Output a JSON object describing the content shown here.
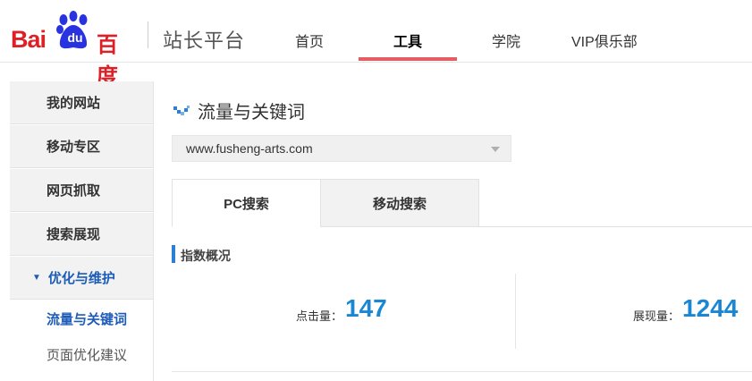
{
  "header": {
    "logo_latin": "Bai",
    "logo_du": "du",
    "logo_cn": "百度",
    "brand": "站长平台",
    "nav": [
      "首页",
      "工具",
      "学院",
      "VIP俱乐部"
    ],
    "active_nav": "工具",
    "accent": "#e55c62",
    "logo_red": "#de1f26",
    "logo_blue": "#2932e1"
  },
  "sidebar": {
    "items": [
      {
        "label": "我的网站"
      },
      {
        "label": "移动专区"
      },
      {
        "label": "网页抓取"
      },
      {
        "label": "搜索展现"
      },
      {
        "label": "优化与维护",
        "expanded": true
      }
    ],
    "sub_items": [
      {
        "label": "流量与关键词",
        "active": true
      },
      {
        "label": "页面优化建议"
      }
    ],
    "active_color": "#1c5cb8"
  },
  "main": {
    "title": "流量与关键词",
    "title_icon": "chevron-down-check-icon",
    "site_select": {
      "value": "www.fusheng-arts.com"
    },
    "tabs": [
      {
        "label": "PC搜索",
        "active": true
      },
      {
        "label": "移动搜索"
      }
    ],
    "section_title": "指数概况",
    "metrics": [
      {
        "label": "点击量：",
        "value": "147"
      },
      {
        "label": "展现量：",
        "value": "1244"
      }
    ],
    "value_color": "#1b87d4"
  }
}
